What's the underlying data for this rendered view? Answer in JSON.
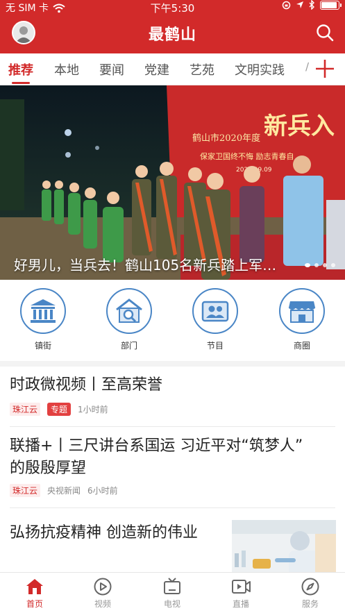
{
  "status_bar": {
    "carrier": "无 SIM 卡",
    "time": "下午5:30",
    "battery_level": 0.92
  },
  "header": {
    "title": "最鹤山",
    "avatar_icon": "user-avatar-icon",
    "search_icon": "search-icon"
  },
  "tabs": {
    "items": [
      {
        "label": "推荐",
        "active": true
      },
      {
        "label": "本地"
      },
      {
        "label": "要闻"
      },
      {
        "label": "党建"
      },
      {
        "label": "艺苑"
      },
      {
        "label": "文明实践"
      }
    ],
    "more_label": "/",
    "add_icon": "plus-icon"
  },
  "banner": {
    "caption": "好男儿，当兵去！鹤山105名新兵踏上军…",
    "dots_count": 4,
    "active_dot": 1,
    "image_text": {
      "sign_title": "鹤山市2020年度",
      "sign_big": "新兵入",
      "sign_slogan": "保家卫国终不悔   励志青春自",
      "sign_date": "2020.09.09"
    }
  },
  "quick_entries": [
    {
      "label": "镇街",
      "icon": "government-building-icon"
    },
    {
      "label": "部门",
      "icon": "house-search-icon"
    },
    {
      "label": "节目",
      "icon": "profile-card-icon"
    },
    {
      "label": "商圈",
      "icon": "shop-icon"
    }
  ],
  "news": [
    {
      "title": "时政微视频丨至高荣誉",
      "source": "珠江云",
      "badge": "专题",
      "time": "1小时前"
    },
    {
      "title_line1": "联播+丨三尺讲台系国运 习近平对“筑梦人”",
      "title_line2": "的殷殷厚望",
      "source": "珠江云",
      "publisher": "央视新闻",
      "time": "6小时前"
    },
    {
      "title": "弘扬抗疫精神 创造新的伟业",
      "thumbnail": "lab-worker-thumbnail"
    }
  ],
  "bottom_nav": [
    {
      "label": "首页",
      "icon": "home-icon",
      "active": true
    },
    {
      "label": "视频",
      "icon": "play-circle-icon"
    },
    {
      "label": "电视",
      "icon": "tv-icon"
    },
    {
      "label": "直播",
      "icon": "live-camera-icon"
    },
    {
      "label": "服务",
      "icon": "compass-icon"
    }
  ],
  "colors": {
    "brand": "#d22a2a",
    "icon_blue": "#4a86c6"
  }
}
